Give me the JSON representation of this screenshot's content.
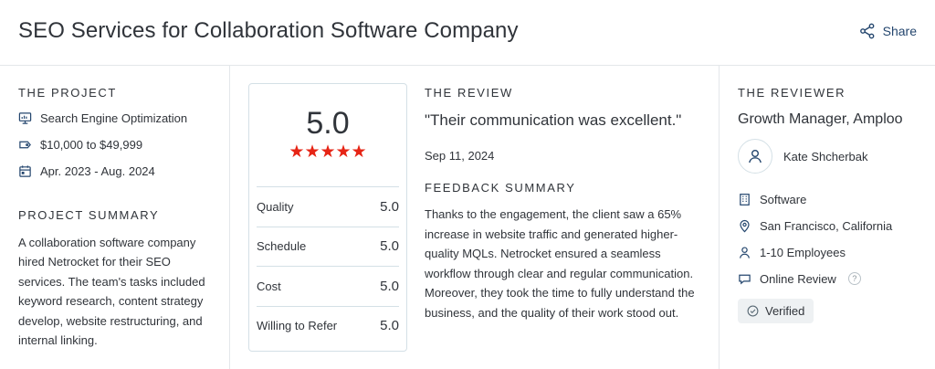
{
  "header": {
    "title": "SEO Services for Collaboration Software Company",
    "share_label": "Share"
  },
  "project": {
    "heading": "THE PROJECT",
    "meta": [
      {
        "icon": "monitor-icon",
        "text": "Search Engine Optimization"
      },
      {
        "icon": "price-tag-icon",
        "text": "$10,000 to $49,999"
      },
      {
        "icon": "calendar-icon",
        "text": "Apr. 2023 - Aug. 2024"
      }
    ],
    "summary_heading": "PROJECT SUMMARY",
    "summary_text": "A collaboration software company hired Netrocket for their SEO services. The team's tasks included keyword research, content strategy develop, website restructuring, and internal linking."
  },
  "ratings": {
    "overall": "5.0",
    "stars": "★★★★★",
    "rows": [
      {
        "label": "Quality",
        "value": "5.0"
      },
      {
        "label": "Schedule",
        "value": "5.0"
      },
      {
        "label": "Cost",
        "value": "5.0"
      },
      {
        "label": "Willing to Refer",
        "value": "5.0"
      }
    ]
  },
  "review": {
    "heading": "THE REVIEW",
    "quote": "\"Their communication was excellent.\"",
    "date": "Sep 11, 2024",
    "feedback_heading": "FEEDBACK SUMMARY",
    "feedback_text": "Thanks to the engagement, the client saw a 65% increase in website traffic and generated higher-quality MQLs. Netrocket ensured a seamless workflow through clear and regular communication. Moreover, they took the time to fully understand the business, and the quality of their work stood out."
  },
  "reviewer": {
    "heading": "THE REVIEWER",
    "role": "Growth Manager, Amploo",
    "name": "Kate Shcherbak",
    "meta": [
      {
        "icon": "building-icon",
        "text": "Software"
      },
      {
        "icon": "location-pin-icon",
        "text": "San Francisco, California"
      },
      {
        "icon": "user-icon",
        "text": "1-10 Employees"
      },
      {
        "icon": "chat-bubble-icon",
        "text": "Online Review"
      }
    ],
    "help_glyph": "?",
    "verified_label": "Verified"
  },
  "colors": {
    "text": "#30343a",
    "link": "#24466e",
    "stars": "#e62415",
    "border": "#d4e0e6"
  }
}
